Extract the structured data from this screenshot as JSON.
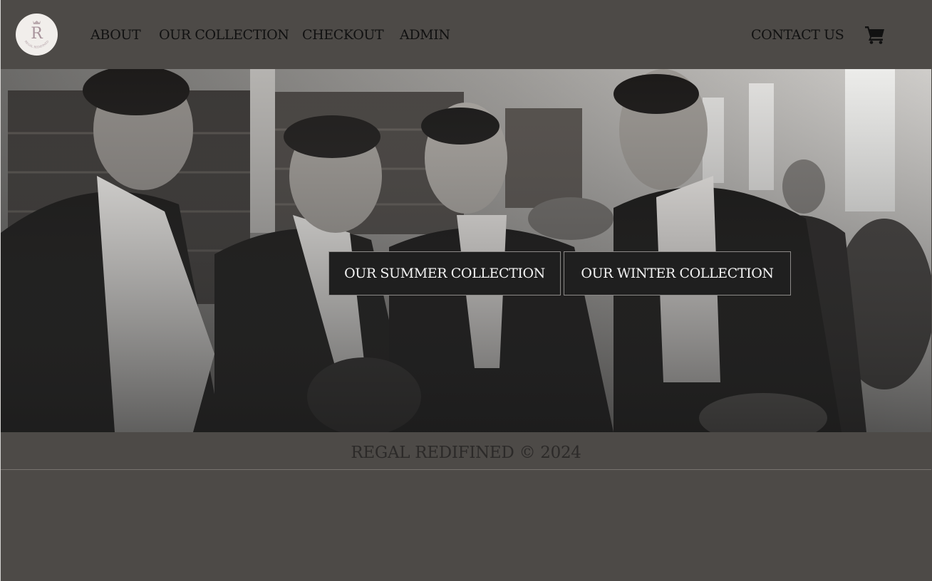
{
  "brand": {
    "logo_letter": "R",
    "logo_ring_text": "REGAL REDIFINED"
  },
  "nav": {
    "about": "ABOUT",
    "collection": "OUR COLLECTION",
    "checkout": "CHECKOUT",
    "admin": "ADMIN",
    "contact": "CONTACT US",
    "cart_icon": "shopping-cart-icon"
  },
  "hero": {
    "summer_button": "OUR SUMMER COLLECTION",
    "winter_button": "OUR WINTER COLLECTION"
  },
  "footer": {
    "copyright": "REGAL REDIFINED © 2024"
  },
  "colors": {
    "background": "#4d4a47",
    "button_bg": "#1f1f1f",
    "nav_text": "#111111"
  }
}
